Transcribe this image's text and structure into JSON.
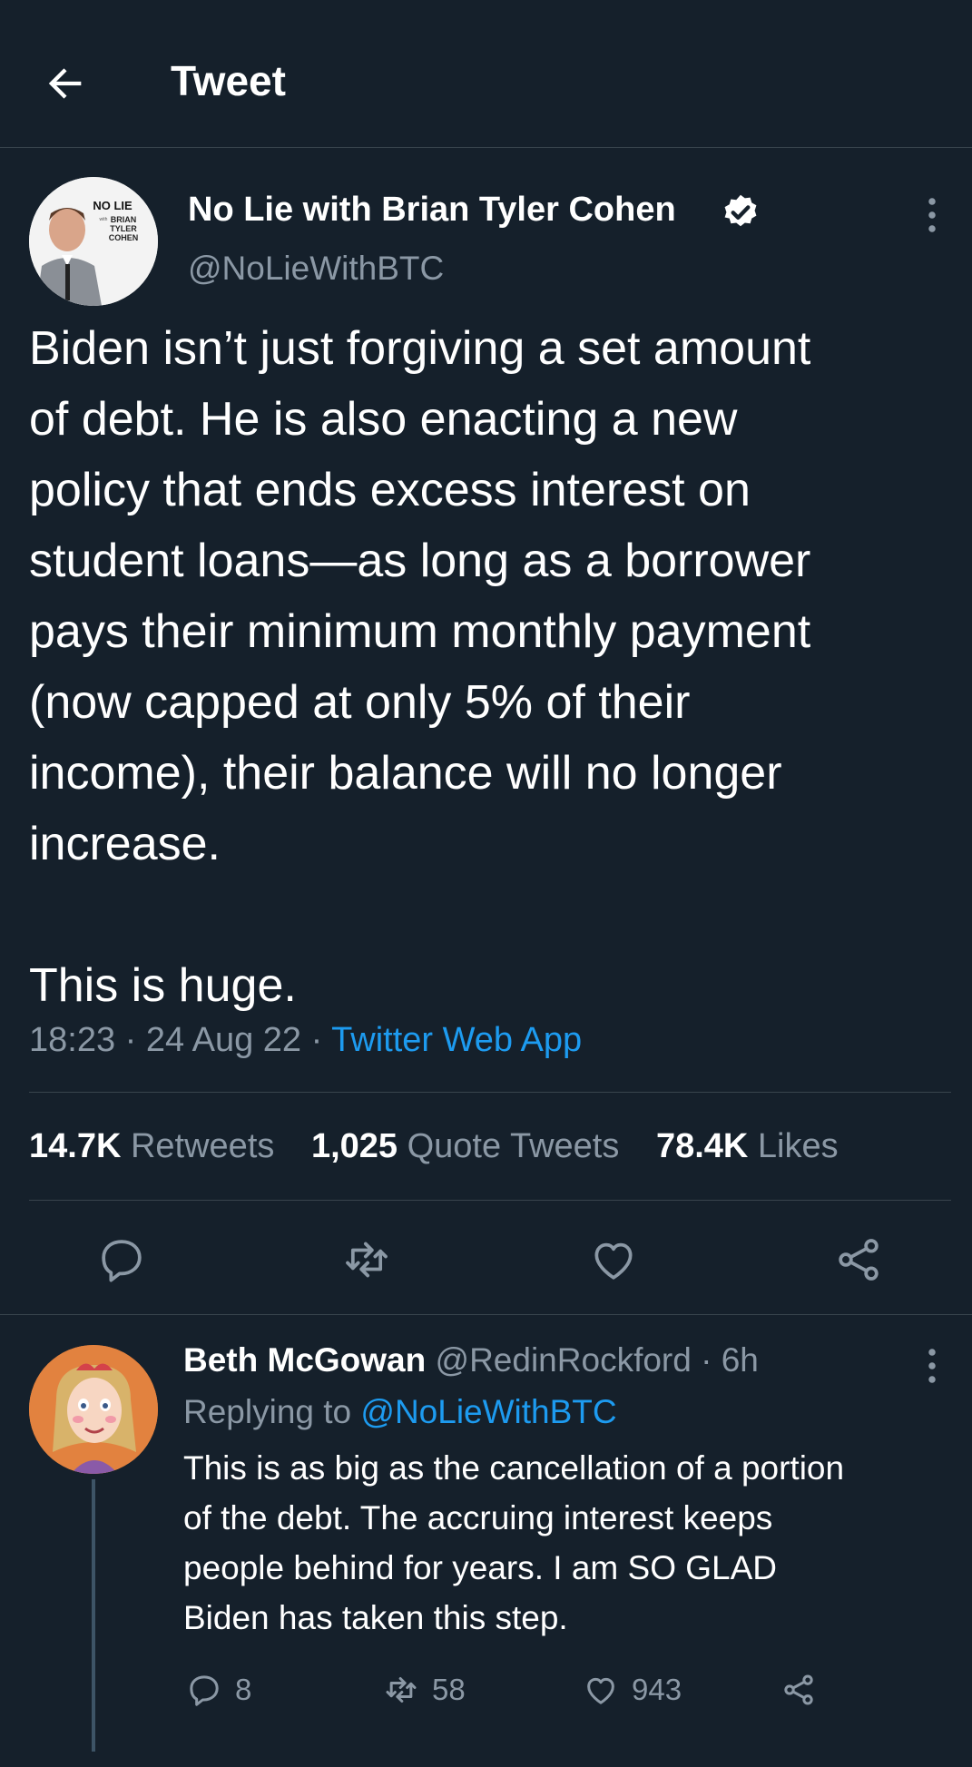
{
  "header": {
    "title": "Tweet"
  },
  "tweet": {
    "author_name": "No Lie with Brian Tyler Cohen",
    "author_handle": "@NoLieWithBTC",
    "avatar_logo": {
      "line1": "NO LIE",
      "line2": "with",
      "line3": "BRIAN",
      "line4": "TYLER",
      "line5": "COHEN"
    },
    "text": "Biden isn’t just forgiving a set amount\nof debt. He is also enacting a new\npolicy that ends excess interest on\nstudent loans—as long as a borrower\npays their minimum monthly payment\n(now capped at only 5% of their\nincome), their balance will no longer\nincrease.\n\nThis is huge.",
    "time": "18:23",
    "date": "24 Aug 22",
    "app": "Twitter Web App",
    "stats": {
      "retweets": "14.7K",
      "retweets_label": "Retweets",
      "quotes": "1,025",
      "quotes_label": "Quote Tweets",
      "likes": "78.4K",
      "likes_label": "Likes"
    }
  },
  "reply": {
    "name": "Beth McGowan",
    "handle": "@RedinRockford",
    "time": "6h",
    "replying_label": "Replying to",
    "replying_to": "@NoLieWithBTC",
    "text": "This is as big as the cancellation of a portion\nof the debt. The accruing interest keeps\npeople behind for years. I am SO GLAD\nBiden has taken this step.",
    "replies": "8",
    "retweets": "58",
    "likes": "943"
  },
  "colors": {
    "background": "#15202b",
    "accent": "#1d9bf0",
    "muted": "#8b98a5",
    "divider": "#38444d"
  }
}
